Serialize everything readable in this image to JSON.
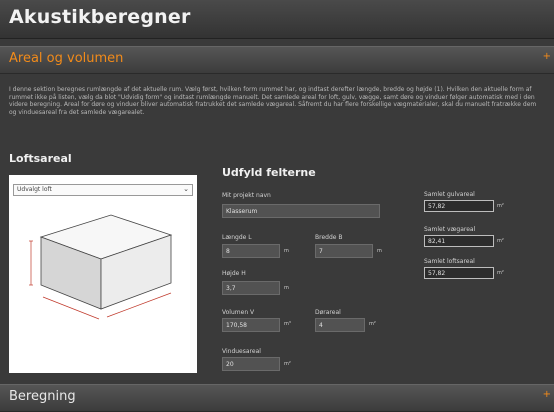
{
  "header": {
    "title": "Akustikberegner"
  },
  "section_area": {
    "title": "Areal og volumen",
    "toggle": "+"
  },
  "intro": "I denne sektion beregnes rumlængde af det aktuelle rum. Vælg først, hvilken form rummet har, og indtast derefter længde, bredde og højde (1). Hvilken den aktuelle form af rummet ikke på listen, vælg da blot \"Udvidig form\" og indtast rumlængde manuelt. Det samlede areal for loft, gulv, vægge, samt døre og vinduer følger automatisk med i den videre beregning. Areal for døre og vinduer bliver automatisk fratrukket det samlede vægareal. Såfremt du har flere forskellige vægmaterialer, skal du manuelt fratrække dem og vinduesareal fra det samlede vægarealet.",
  "ceiling": {
    "heading": "Loftsareal",
    "shape_select": "Udvalgt loft",
    "shape_icon": "chevron-down-icon"
  },
  "form": {
    "heading": "Udfyld felterne",
    "project_name_label": "Mit projekt navn",
    "project_name_value": "Klasserum",
    "length_label": "Længde L",
    "length_value": "8",
    "width_label": "Bredde B",
    "width_value": "7",
    "height_label": "Højde H",
    "height_value": "3,7",
    "volume_label": "Volumen V",
    "volume_value": "170,58",
    "door_label": "Dørareal",
    "door_value": "4",
    "window_label": "Vinduesareal",
    "window_value": "20",
    "unit_m": "m",
    "unit_m2": "m²",
    "unit_m3": "m³"
  },
  "results": {
    "floor_label": "Samlet gulvareal",
    "floor_value": "57,82",
    "wall_label": "Samlet vægareal",
    "wall_value": "82,41",
    "ceiling_label": "Samlet loftsareal",
    "ceiling_value": "57,82",
    "unit_m2": "m²"
  },
  "section_calc": {
    "title": "Beregning",
    "toggle": "+"
  },
  "colors": {
    "accent": "#f28b1a",
    "background": "#3a3a3a",
    "input_bg": "#525252"
  }
}
